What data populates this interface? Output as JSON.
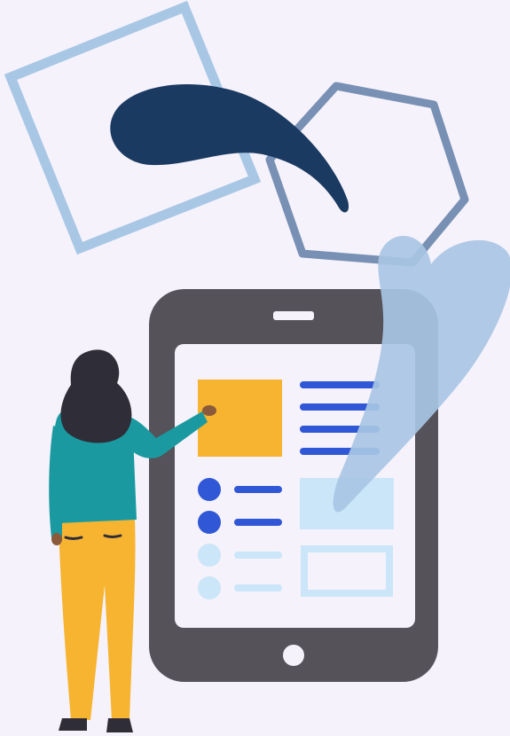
{
  "illustration": {
    "subject": "woman-interacting-with-tablet",
    "icons": [
      "square-outline-shape",
      "hexagon-outline-shape",
      "navy-leaf-blob",
      "light-blue-leaf-blob"
    ]
  },
  "tablet": {
    "screen_rows": [
      {
        "kind": "bullet",
        "state": "active"
      },
      {
        "kind": "bullet",
        "state": "active"
      },
      {
        "kind": "bullet",
        "state": "inactive"
      },
      {
        "kind": "bullet",
        "state": "inactive"
      }
    ]
  },
  "colors": {
    "background": "#f5f2fb",
    "tablet_body": "#55525a",
    "screen": "#f5f2fb",
    "accent_yellow": "#f6b431",
    "accent_blue": "#3057d5",
    "light_blue": "#cbe6f8",
    "navy": "#1b3a61",
    "square_outline": "#a8c7e5",
    "hexagon_outline": "#7890b3",
    "blob_light": "#a8c6e4",
    "shirt_teal": "#1a9aa0",
    "pants_yellow": "#f6b431",
    "hair": "#2f2d38"
  }
}
